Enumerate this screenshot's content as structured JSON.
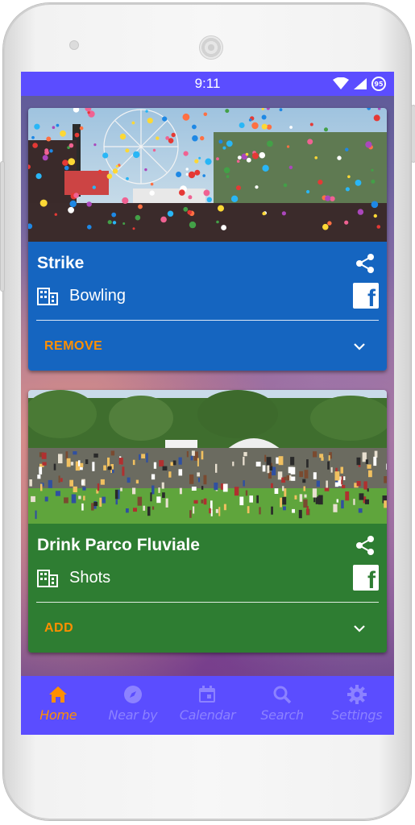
{
  "status_bar": {
    "time": "9:11",
    "battery_level": "95",
    "icons": [
      "wifi-icon",
      "cell-signal-icon",
      "battery-icon"
    ]
  },
  "cards": [
    {
      "title": "Strike",
      "category": "Bowling",
      "action_label": "REMOVE",
      "color": "#1565c0"
    },
    {
      "title": "Drink Parco Fluviale",
      "category": "Shots",
      "action_label": "ADD",
      "color": "#2e7d32"
    }
  ],
  "bottom_nav": {
    "items": [
      {
        "label": "Home",
        "icon": "home-icon",
        "active": true
      },
      {
        "label": "Near by",
        "icon": "compass-icon",
        "active": false
      },
      {
        "label": "Calendar",
        "icon": "calendar-icon",
        "active": false
      },
      {
        "label": "Search",
        "icon": "search-icon",
        "active": false
      },
      {
        "label": "Settings",
        "icon": "gear-icon",
        "active": false
      }
    ]
  },
  "colors": {
    "accent": "#ff8f00",
    "bar": "#5b4dff",
    "nav_inactive": "#8c82ff"
  }
}
